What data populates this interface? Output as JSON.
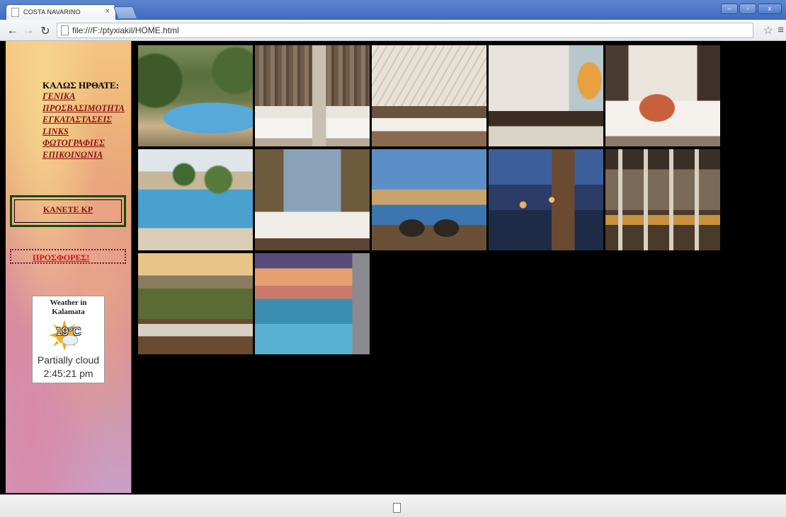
{
  "browser": {
    "tab_title": "COSTA NAVARINO",
    "tab_close": "×",
    "url": "file:///F:/ptyxiakil/HOME.html",
    "window_buttons": [
      "–",
      "▫",
      "x"
    ]
  },
  "sidebar": {
    "welcome": "ΚΑΛΩΣ ΗΡΘΑΤΕ:",
    "links": [
      "ΓΕΝΙΚΑ",
      "ΠΡΟΣΒΑΣΙΜΟΤΗΤΑ",
      "ΕΓΚΑΤΑΣΤΑΣΕΙΣ",
      "LINKS",
      "ΦΩΤΟΓΡΑΦΙΕΣ",
      "ΕΠΙΚΟΙΝΩΝΙΑ"
    ],
    "booking_link": "ΚΑΝΕΤΕ ΚΡ",
    "offers_link": "ΠΡΟΣΦΟΡΕΣ!"
  },
  "weather": {
    "title": "Weather in Kalamata",
    "temperature": "19°C",
    "condition": "Partially cloud",
    "time": "2:45:21 pm"
  },
  "gallery": {
    "photos": [
      "olive-garden-pool",
      "marble-bathroom",
      "vaulted-bedroom",
      "lounge-chair-room",
      "bed-with-pillows",
      "resort-pool-palms",
      "suite-bed-sea-view",
      "infinity-pool-dusk",
      "sunset-terrace-lights",
      "stone-bar-hall",
      "golf-terrace-sofa",
      "sunset-infinity-pool"
    ]
  }
}
